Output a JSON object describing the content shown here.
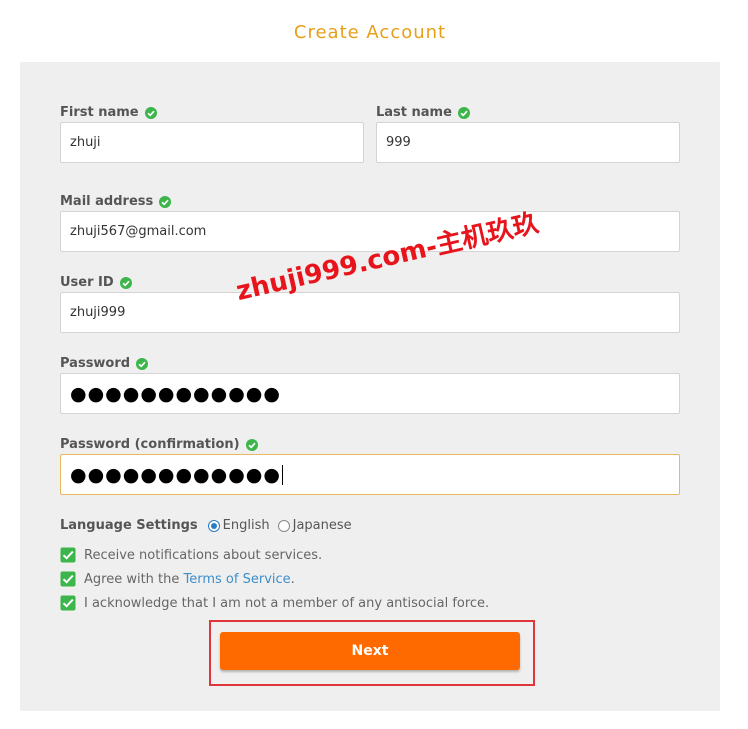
{
  "title": "Create Account",
  "fields": {
    "first_name": {
      "label": "First name",
      "value": "zhuji"
    },
    "last_name": {
      "label": "Last name",
      "value": "999"
    },
    "mail": {
      "label": "Mail address",
      "value": "zhuji567@gmail.com"
    },
    "user_id": {
      "label": "User ID",
      "value": "zhuji999"
    },
    "password": {
      "label": "Password",
      "value": "●●●●●●●●●●●●"
    },
    "password_confirm": {
      "label": "Password (confirmation)",
      "value": "●●●●●●●●●●●●"
    }
  },
  "language": {
    "title": "Language Settings",
    "options": [
      "English",
      "Japanese"
    ],
    "selected": "English"
  },
  "agreements": {
    "notify": "Receive notifications about services.",
    "agree_prefix": "Agree with the ",
    "tos_link": "Terms of Service",
    "agree_suffix": ".",
    "antisocial": "I acknowledge that I am not a member of any antisocial force."
  },
  "next_button": "Next",
  "watermark": "zhuji999.com-主机玖玖",
  "colors": {
    "title": "#e6a019",
    "valid_check": "#3cb54a",
    "next_button": "#ff6a00",
    "highlight_frame": "#e0363b",
    "link": "#3d8ec9"
  }
}
